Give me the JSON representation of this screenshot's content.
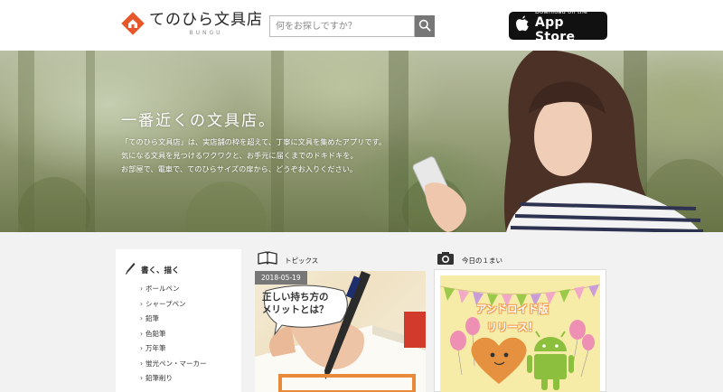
{
  "header": {
    "logo_title": "てのひら文具店",
    "logo_sub": "BUNGU",
    "search_placeholder": "何をお探しですか？",
    "appstore_small": "Download on the",
    "appstore_big": "App Store"
  },
  "hero": {
    "headline": "一番近くの文具店。",
    "body_lines": [
      "「てのひら文具店」は、実店舗の枠を超えて、丁寧に文具を集めたアプリです。",
      "気になる文具を見つけるワクワクと、お手元に届くまでのドキドキを。",
      "お部屋で、電車で、てのひらサイズの扉から、どうぞお入りください。"
    ]
  },
  "sidebar": {
    "heading": "書く、描く",
    "items": [
      {
        "label": "ボールペン"
      },
      {
        "label": "シャープペン"
      },
      {
        "label": "鉛筆"
      },
      {
        "label": "色鉛筆"
      },
      {
        "label": "万年筆"
      },
      {
        "label": "蛍光ペン・マーカー"
      },
      {
        "label": "鉛筆削り"
      }
    ]
  },
  "topics": {
    "heading": "トピックス",
    "date": "2018-05-19",
    "bubble_line1": "正しい持ち方の",
    "bubble_line2": "メリットとは？"
  },
  "today": {
    "heading": "今日の１まい",
    "line1": "アンドロイド版",
    "line2": "リリース！"
  },
  "icons": {
    "logo": "house-logo-icon",
    "search": "search-icon",
    "apple": "apple-icon",
    "pen": "pen-icon",
    "book": "book-icon",
    "camera": "camera-icon"
  },
  "colors": {
    "logo_orange": "#e8572a",
    "search_button": "#777777",
    "today_bg": "#f7eca7",
    "android_green": "#8dbf3f"
  }
}
